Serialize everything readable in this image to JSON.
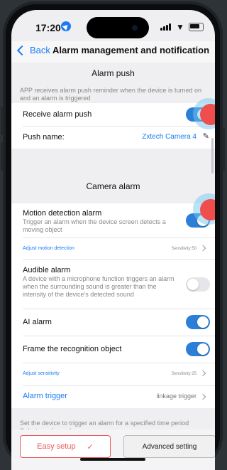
{
  "status_bar": {
    "time": "17:20"
  },
  "nav": {
    "back_label": "Back",
    "title": "Alarm management and notification"
  },
  "alarm_push": {
    "title": "Alarm push",
    "description": "APP receives alarm push reminder when the device is turned on and an alarm is triggered",
    "receive_label": "Receive alarm push",
    "receive_on": true,
    "push_name_label": "Push name:",
    "push_name_value": "Zxtech Camera 4"
  },
  "camera_alarm": {
    "title": "Camera alarm",
    "motion": {
      "label": "Motion detection alarm",
      "description": "Trigger an alarm when the device screen detects a moving object",
      "on": true,
      "adjust_label": "Adjust motion detection",
      "sensitivity": "Sensitivity:50"
    },
    "audible": {
      "label": "Audible alarm",
      "description": "A device with a microphone function triggers an alarm when the surrounding sound is greater than the intensity of the device's detected sound",
      "on": false
    },
    "ai": {
      "label": "AI alarm",
      "on": true
    },
    "frame": {
      "label": "Frame the recognition object",
      "on": true,
      "adjust_label": "Adjust sensitivity",
      "sensitivity": "Sensitivity:25"
    },
    "trigger": {
      "label": "Alarm trigger",
      "value": "linkage trigger"
    }
  },
  "plan": {
    "description_line1": "Set the device to trigger an alarm for a specified time period",
    "description_line2": "Select an alarm plan:"
  },
  "bottom": {
    "easy_label": "Easy setup",
    "advanced_label": "Advanced setting"
  },
  "colors": {
    "accent": "#2c7fd6",
    "link": "#1b7cf2",
    "easy": "#e85a5a",
    "touch": "#f04d4d"
  }
}
